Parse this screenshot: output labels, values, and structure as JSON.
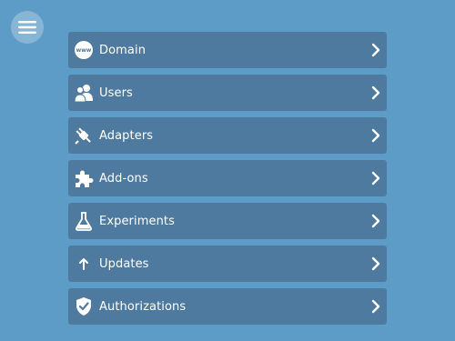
{
  "menu": {
    "items": [
      {
        "label": "Domain",
        "icon": "www-globe-icon"
      },
      {
        "label": "Users",
        "icon": "users-icon"
      },
      {
        "label": "Adapters",
        "icon": "plug-icon"
      },
      {
        "label": "Add-ons",
        "icon": "puzzle-icon"
      },
      {
        "label": "Experiments",
        "icon": "flask-icon"
      },
      {
        "label": "Updates",
        "icon": "arrow-up-icon"
      },
      {
        "label": "Authorizations",
        "icon": "shield-check-icon"
      }
    ]
  },
  "colors": {
    "background": "#5e9cc8",
    "item_background": "#4e7a9f",
    "text": "#ffffff"
  }
}
